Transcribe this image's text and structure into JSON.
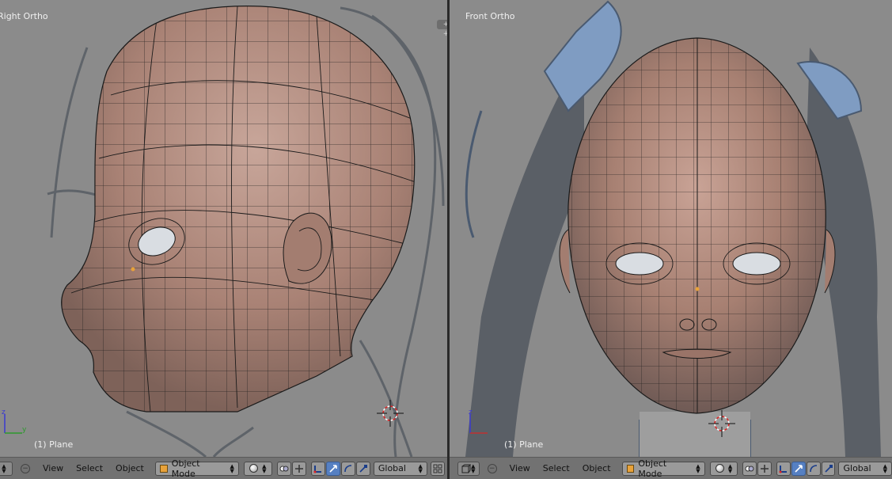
{
  "left_viewport": {
    "title": "Right Ortho",
    "object_label": "(1) Plane"
  },
  "right_viewport": {
    "title": "Front Ortho",
    "object_label": "(1) Plane"
  },
  "split_handle": "+ +",
  "axis_labels": {
    "z": "z",
    "y": "y"
  },
  "left_header": {
    "menus": [
      "View",
      "Select",
      "Object"
    ],
    "mode": "Object Mode",
    "orientation": "Global"
  },
  "right_header": {
    "menus": [
      "View",
      "Select",
      "Object"
    ],
    "mode": "Object Mode",
    "orientation": "Global"
  },
  "icons": {
    "editor_type": "view3d-icon",
    "mode": "cube-icon",
    "shading": "sphere-icon",
    "pivot": "pivot-icon",
    "manipulator": "manipulator-icon",
    "translate": "translate-icon",
    "rotate": "rotate-icon",
    "scale": "scale-icon"
  },
  "colors": {
    "viewport_bg": "#8b8b8b",
    "skin": "#b08a7e",
    "wire": "#1a1a1a",
    "hair_ref": "#5a5f66",
    "ribbon_ref": "#7f9cc2",
    "header": "#727272",
    "active_button": "#5680c2"
  }
}
